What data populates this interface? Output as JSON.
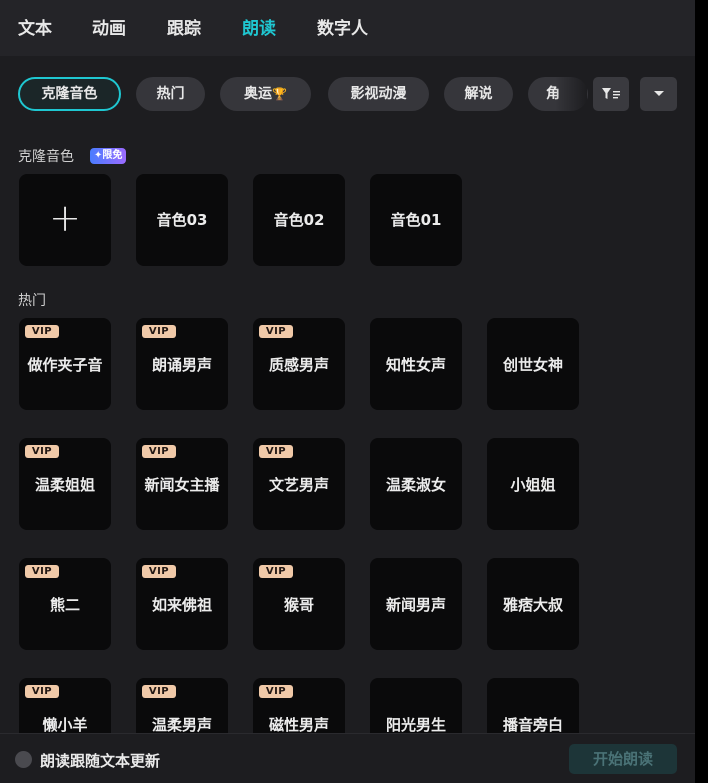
{
  "tabs": [
    "文本",
    "动画",
    "跟踪",
    "朗读",
    "数字人"
  ],
  "active_tab": "朗读",
  "categories": [
    "克隆音色",
    "热门",
    "奥运",
    "影视动漫",
    "解说",
    "角色"
  ],
  "categories_visible_labels": [
    "克隆音色",
    "热门",
    "奥运",
    "影视动漫",
    "解说",
    "角"
  ],
  "filter_icon": "filter-icon",
  "dropdown_icon": "chevron-down-icon",
  "clone_section": {
    "title": "克隆音色",
    "badge": "✦限免",
    "add_icon": "+",
    "voices": [
      "音色03",
      "音色02",
      "音色01"
    ]
  },
  "hot_section": {
    "title": "热门",
    "vip_label": "VIP",
    "voices": [
      {
        "name": "做作夹子音",
        "vip": true
      },
      {
        "name": "朗诵男声",
        "vip": true
      },
      {
        "name": "质感男声",
        "vip": true
      },
      {
        "name": "知性女声",
        "vip": false
      },
      {
        "name": "创世女神",
        "vip": false
      },
      {
        "name": "温柔姐姐",
        "vip": true
      },
      {
        "name": "新闻女主播",
        "vip": true
      },
      {
        "name": "文艺男声",
        "vip": true
      },
      {
        "name": "温柔淑女",
        "vip": false
      },
      {
        "name": "小姐姐",
        "vip": false
      },
      {
        "name": "熊二",
        "vip": true
      },
      {
        "name": "如来佛祖",
        "vip": true
      },
      {
        "name": "猴哥",
        "vip": true
      },
      {
        "name": "新闻男声",
        "vip": false
      },
      {
        "name": "雅痞大叔",
        "vip": false
      },
      {
        "name": "懒小羊",
        "vip": true
      },
      {
        "name": "温柔男声",
        "vip": true
      },
      {
        "name": "磁性男声",
        "vip": true
      },
      {
        "name": "阳光男生",
        "vip": false
      },
      {
        "name": "播音旁白",
        "vip": false
      }
    ]
  },
  "bottom": {
    "toggle_label": "朗读跟随文本更新",
    "start_button": "开始朗读"
  }
}
